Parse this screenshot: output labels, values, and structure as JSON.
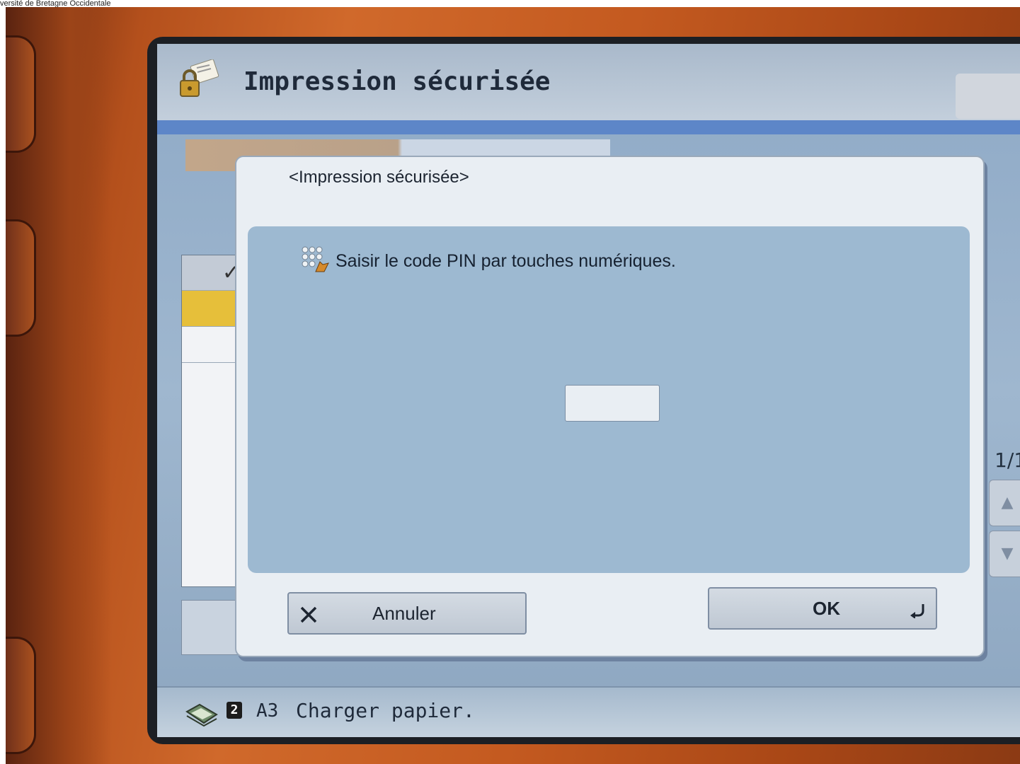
{
  "caption": "versité de Bretagne Occidentale",
  "header": {
    "title": "Impression sécurisée"
  },
  "background": {
    "page_indicator": "1/1"
  },
  "dialog": {
    "title": "<Impression sécurisée>",
    "prompt": "Saisir le code PIN par touches numériques.",
    "pin_value": "",
    "cancel_label": "Annuler",
    "ok_label": "OK"
  },
  "status": {
    "tray_number": "2",
    "paper_size": "A3",
    "message": "Charger papier."
  },
  "colors": {
    "bezel": "#c45a20",
    "screen_bg": "#9fb7cf",
    "dialog_bg": "#e9eef3",
    "dialog_body": "#9db9d1",
    "accent_stripe": "#5d86c8",
    "highlight_row": "#e6bf3a"
  },
  "icons": [
    "lock-icon",
    "pin-keypad-icon",
    "x-icon",
    "enter-icon",
    "paper-tray-icon",
    "check-icon",
    "up-arrow-icon",
    "down-arrow-icon"
  ]
}
